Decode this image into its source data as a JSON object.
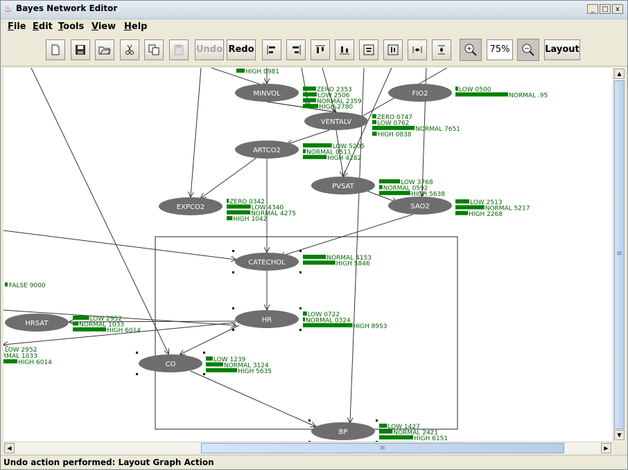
{
  "window": {
    "title": "Bayes Network Editor",
    "controls": {
      "minimize": "_",
      "maximize": "□",
      "close": "x"
    }
  },
  "menubar": {
    "items": [
      {
        "label": "File",
        "mnemonic": "F"
      },
      {
        "label": "Edit",
        "mnemonic": "E"
      },
      {
        "label": "Tools",
        "mnemonic": "T"
      },
      {
        "label": "View",
        "mnemonic": "V"
      },
      {
        "label": "Help",
        "mnemonic": "H"
      }
    ]
  },
  "toolbar": {
    "undo_label": "Undo",
    "redo_label": "Redo",
    "zoom_value": "75%",
    "layout_label": "Layout",
    "icons": [
      "new-file-icon",
      "save-icon",
      "open-icon",
      "cut-icon",
      "copy-icon",
      "paste-icon",
      "align-left-icon",
      "align-right-icon",
      "align-top-icon",
      "align-bottom-icon",
      "center-horizontal-icon",
      "center-vertical-icon",
      "space-horizontal-icon",
      "space-vertical-icon",
      "zoom-in-icon",
      "zoom-out-icon"
    ]
  },
  "colors": {
    "node_fill": "#6e6e6e",
    "node_text": "#ffffff",
    "bar_color": "#008000",
    "label_color": "#006400",
    "edge_color": "#333333"
  },
  "graph": {
    "nodes": [
      {
        "name": "MINVOL",
        "states": [
          "ZERO 2353",
          "LOW 2506",
          "NORMAL 2359",
          "HIGH 2780"
        ],
        "values": [
          0.2353,
          0.2506,
          0.2359,
          0.278
        ]
      },
      {
        "name": "FIO2",
        "states": [
          "LOW 0500",
          "NORMAL .95"
        ],
        "values": [
          0.05,
          0.95
        ]
      },
      {
        "name": "VENTALV",
        "states": [
          "ZERO 0747",
          "LOW 0762",
          "NORMAL 7651",
          "HIGH 0838"
        ],
        "values": [
          0.0747,
          0.0762,
          0.7651,
          0.0838
        ]
      },
      {
        "name": "ARTCO2",
        "states": [
          "LOW 5205",
          "NORMAL 0511",
          "HIGH 4282"
        ],
        "values": [
          0.5205,
          0.0511,
          0.4282
        ]
      },
      {
        "name": "PVSAT",
        "states": [
          "LOW 3768",
          "NORMAL 0592",
          "HIGH 5638"
        ],
        "values": [
          0.3768,
          0.0592,
          0.5638
        ]
      },
      {
        "name": "EXPCO2",
        "states": [
          "ZERO 0342",
          "LOW 4340",
          "NORMAL 4275",
          "HIGH 1042"
        ],
        "values": [
          0.0342,
          0.434,
          0.4275,
          0.1042
        ]
      },
      {
        "name": "SAO2",
        "states": [
          "LOW 2513",
          "NORMAL 5217",
          "HIGH 2268"
        ],
        "values": [
          0.2513,
          0.5217,
          0.2268
        ]
      },
      {
        "name": "CATECHOL",
        "states": [
          "NORMAL 4153",
          "HIGH 5846"
        ],
        "values": [
          0.4153,
          0.5846
        ]
      },
      {
        "name": "HR",
        "states": [
          "LOW 0722",
          "NORMAL 0324",
          "HIGH 8953"
        ],
        "values": [
          0.0722,
          0.0324,
          0.8953
        ]
      },
      {
        "name": "HRSAT",
        "states": [
          "LOW 2952",
          "NORMAL 1033",
          "HIGH 6014"
        ],
        "values": [
          0.2952,
          0.1033,
          0.6014
        ]
      },
      {
        "name": "CO",
        "states": [
          "LOW 1239",
          "NORMAL 3124",
          "HIGH 5635"
        ],
        "values": [
          0.1239,
          0.3124,
          0.5635
        ]
      },
      {
        "name": "BP",
        "states": [
          "LOW 1427",
          "NORMAL 2421",
          "HIGH 6151"
        ],
        "values": [
          0.1427,
          0.2421,
          0.6151
        ]
      }
    ],
    "partial_labels": [
      {
        "id": "top-high",
        "text": "HIGH 0981"
      },
      {
        "id": "false",
        "text": "FALSE 9000"
      },
      {
        "id": "left-low",
        "text": "LOW 2952"
      },
      {
        "id": "left-normal",
        "text": "RMAL 1033"
      },
      {
        "id": "left-high",
        "text": "HIGH 6014"
      }
    ]
  },
  "scrollbars": {
    "up": "▲",
    "down": "▼",
    "left": "◀",
    "right": "▶",
    "grip": "≡"
  },
  "status": {
    "text": "Undo action performed:  Layout Graph Action"
  }
}
